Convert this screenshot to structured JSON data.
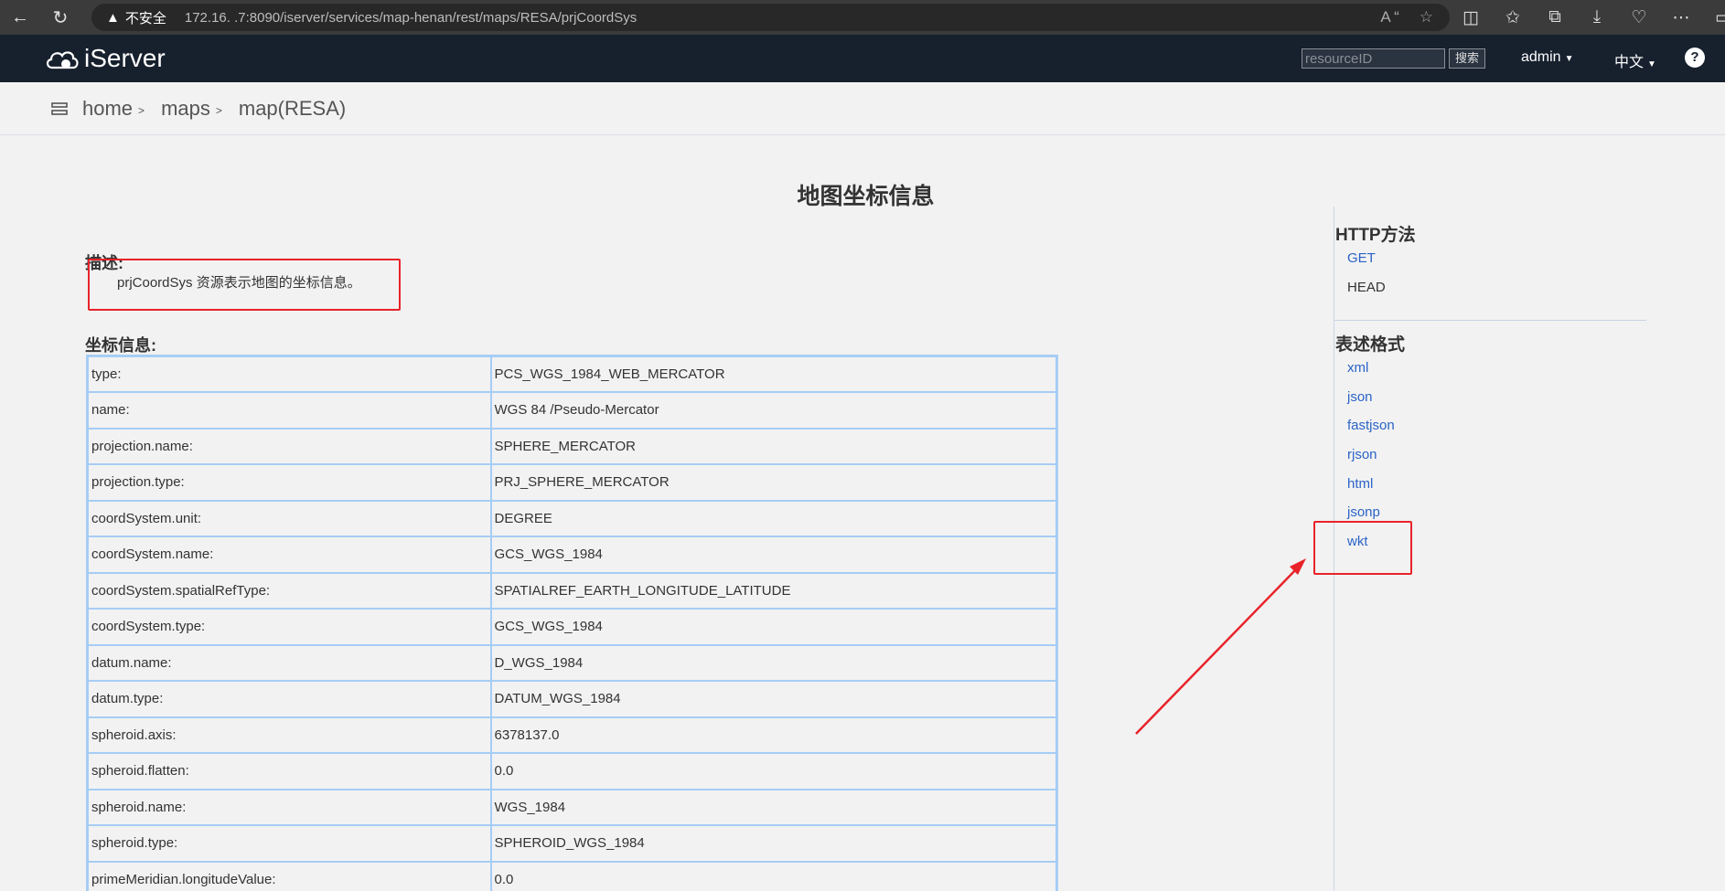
{
  "browser": {
    "security_label": "不安全",
    "url": "172.16.  .7:8090/iserver/services/map-henan/rest/maps/RESA/prjCoordSys"
  },
  "header": {
    "logo": "iServer",
    "search_placeholder": "resourceID",
    "search_button": "搜索",
    "user_menu": "admin",
    "language_menu": "中文",
    "help": "?"
  },
  "breadcrumb": [
    {
      "label": "home"
    },
    {
      "label": "maps"
    },
    {
      "label": "map(RESA)"
    }
  ],
  "main": {
    "title": "地图坐标信息",
    "description_label": "描述:",
    "description_text": "prjCoordSys 资源表示地图的坐标信息。",
    "coord_label": "坐标信息:",
    "rows": [
      {
        "key": "type:",
        "value": "PCS_WGS_1984_WEB_MERCATOR"
      },
      {
        "key": "name:",
        "value": "WGS 84 /Pseudo-Mercator"
      },
      {
        "key": "projection.name:",
        "value": "SPHERE_MERCATOR"
      },
      {
        "key": "projection.type:",
        "value": "PRJ_SPHERE_MERCATOR"
      },
      {
        "key": "coordSystem.unit:",
        "value": "DEGREE"
      },
      {
        "key": "coordSystem.name:",
        "value": "GCS_WGS_1984"
      },
      {
        "key": "coordSystem.spatialRefType:",
        "value": "SPATIALREF_EARTH_LONGITUDE_LATITUDE"
      },
      {
        "key": "coordSystem.type:",
        "value": "GCS_WGS_1984"
      },
      {
        "key": "datum.name:",
        "value": "D_WGS_1984"
      },
      {
        "key": "datum.type:",
        "value": "DATUM_WGS_1984"
      },
      {
        "key": "spheroid.axis:",
        "value": "6378137.0"
      },
      {
        "key": "spheroid.flatten:",
        "value": "0.0"
      },
      {
        "key": "spheroid.name:",
        "value": "WGS_1984"
      },
      {
        "key": "spheroid.type:",
        "value": "SPHEROID_WGS_1984"
      },
      {
        "key": "primeMeridian.longitudeValue:",
        "value": "0.0"
      }
    ]
  },
  "sidebar": {
    "http_heading": "HTTP方法",
    "methods": [
      "GET",
      "HEAD"
    ],
    "format_heading": "表述格式",
    "formats": [
      "xml",
      "json",
      "fastjson",
      "rjson",
      "html",
      "jsonp",
      "wkt"
    ]
  },
  "annotation_color": "#e8232a",
  "link_color": "#2a63c7",
  "header_bg": "#17202d"
}
